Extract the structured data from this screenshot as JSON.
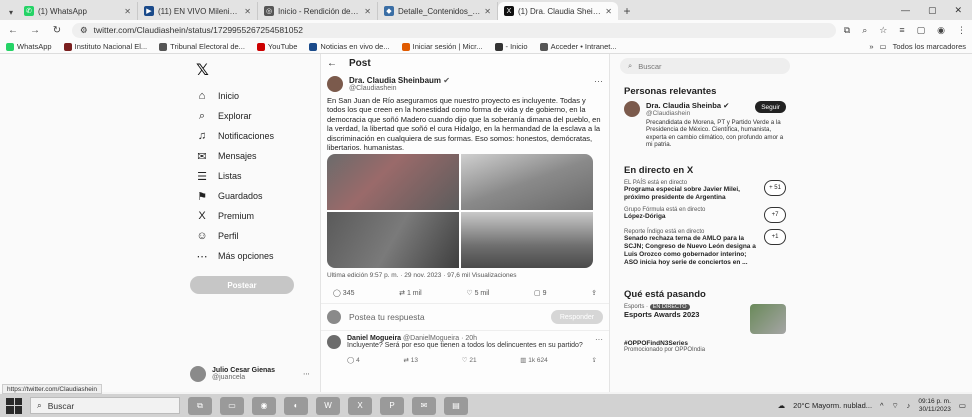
{
  "tabs": [
    {
      "label": "(1) WhatsApp",
      "color": "#25d366",
      "glyph": "✆",
      "active": false
    },
    {
      "label": "(11) EN VIVO Milenio N",
      "color": "#1a4a8a",
      "glyph": "▶",
      "active": false
    },
    {
      "label": "Inicio - Rendición de cuentas",
      "color": "#555555",
      "glyph": "◎",
      "active": false
    },
    {
      "label": "Detalle_Contenidos_PTEO",
      "color": "#3a6ea5",
      "glyph": "◆",
      "active": false
    },
    {
      "label": "(1) Dra. Claudia Sheinbaum",
      "color": "#111111",
      "glyph": "X",
      "active": true
    }
  ],
  "url": "twitter.com/Claudiashein/status/1729955267254581052",
  "bookmarks": [
    {
      "label": "WhatsApp",
      "color": "#25d366"
    },
    {
      "label": "Instituto Nacional El...",
      "color": "#7a1f1f"
    },
    {
      "label": "Tribunal Electoral de...",
      "color": "#555555"
    },
    {
      "label": "YouTube",
      "color": "#cc0000"
    },
    {
      "label": "Noticias en vivo de...",
      "color": "#1a4a8a"
    },
    {
      "label": "Iniciar sesión | Micr...",
      "color": "#e05a00"
    },
    {
      "label": "- Inicio",
      "color": "#333333"
    },
    {
      "label": "Acceder • Intranet...",
      "color": "#555555"
    }
  ],
  "bookmarks_right": "Todos los marcadores",
  "nav": {
    "items": [
      {
        "label": "Inicio",
        "icon": "⌂",
        "name": "home"
      },
      {
        "label": "Explorar",
        "icon": "⌕",
        "name": "explore"
      },
      {
        "label": "Notificaciones",
        "icon": "♫",
        "name": "notifications"
      },
      {
        "label": "Mensajes",
        "icon": "✉",
        "name": "messages"
      },
      {
        "label": "Listas",
        "icon": "☰",
        "name": "lists"
      },
      {
        "label": "Guardados",
        "icon": "⚑",
        "name": "bookmarks"
      },
      {
        "label": "Premium",
        "icon": "X",
        "name": "premium"
      },
      {
        "label": "Perfil",
        "icon": "☺",
        "name": "profile"
      },
      {
        "label": "Más opciones",
        "icon": "⋯",
        "name": "more"
      }
    ],
    "post_button": "Postear"
  },
  "account": {
    "name": "Julio Cesar Gienas",
    "handle": "@juancela"
  },
  "post": {
    "header": "Post",
    "author_name": "Dra. Claudia Sheinbaum",
    "author_handle": "@Claudiashein",
    "text": "En San Juan de Río aseguramos que nuestro proyecto es incluyente. Todas y todos los que creen en la honestidad como forma de vida y de gobierno, en la democracia que soñó Madero cuando dijo que la soberanía dimana del pueblo, en la verdad, la libertad que soñó el cura Hidalgo, en la hermandad de la esclava a la discriminación en cualquiera de sus formas. Eso somos: honestos, demócratas, libertarios, humanistas.",
    "meta": "Ultima edición 9:57 p. m. · 29 nov. 2023 · 97,6 mil Visualizaciones",
    "actions": {
      "replies": "345",
      "reposts": "1 mil",
      "likes": "5 mil",
      "saves": "9"
    },
    "reply_placeholder": "Postea tu respuesta",
    "reply_button": "Responder"
  },
  "reply": {
    "name": "Daniel Mogueira",
    "handle": "@DanielMogueira · 20h",
    "text": "Incluyente? Será por eso que tienen a todos los delincuentes en su partido?",
    "actions": {
      "replies": "4",
      "reposts": "13",
      "likes": "21",
      "views": "1k 624"
    }
  },
  "right": {
    "search_placeholder": "Buscar",
    "relevant_title": "Personas relevantes",
    "relevant": {
      "name": "Dra. Claudia Sheinba",
      "handle": "@Claudiashein",
      "follow": "Seguir",
      "bio": "Precandidata de Morena, PT y Partido Verde a la Presidencia de México. Científica, humanista, experta en cambio climático, con profundo amor a mi patria."
    },
    "live_title": "En directo en X",
    "live": [
      {
        "source": "EL PAÍS está en directo",
        "headline": "Programa especial sobre Javier Milei, próximo presidente de Argentina",
        "badge": "+ 51"
      },
      {
        "source": "Grupo Fórmula está en directo",
        "headline": "López-Dóriga",
        "badge": "+7"
      },
      {
        "source": "Reporte Índigo está en directo",
        "headline": "Senado rechaza terna de AMLO para la SCJN; Congreso de Nuevo León designa a Luis Orozco como gobernador interino; ASO inicia hoy serie de conciertos en ...",
        "badge": "+1"
      }
    ],
    "trends_title": "Qué está pasando",
    "trend_sport": "Esports",
    "trend_badge": "EN DIRECTO",
    "trend_big": "Esports Awards 2023",
    "hashtag": "#OPPOFindN3Series",
    "hashtag_sub": "Promocionado por OPPOIndia"
  },
  "status_url": "https://twitter.com/Claudiashein",
  "taskbar": {
    "search": "Buscar",
    "weather": "20°C Mayorm. nublad...",
    "time": "09:16 p. m.",
    "date": "30/11/2023"
  }
}
